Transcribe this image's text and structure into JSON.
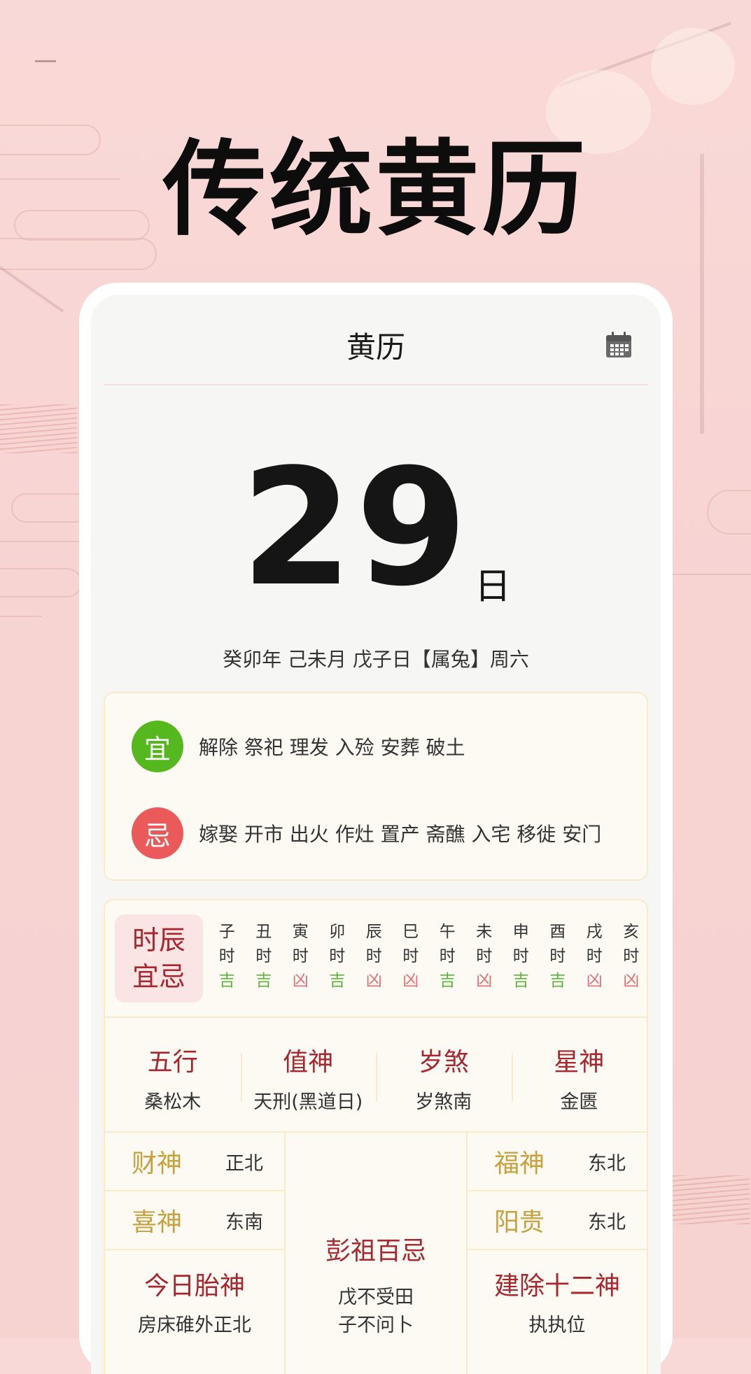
{
  "hero": {
    "title": "传统黄历"
  },
  "app": {
    "title": "黄历",
    "calendar_icon": "calendar-icon"
  },
  "date": {
    "day": "29",
    "unit": "日",
    "ganzhi": "癸卯年 己未月 戊子日【属兔】周六"
  },
  "yiji": {
    "yi_label": "宜",
    "yi_items": "解除 祭祀 理发 入殓 安葬 破土",
    "ji_label": "忌",
    "ji_items": "嫁娶 开市 出火 作灶 置产 斋醮 入宅 移徙 安门",
    "colors": {
      "yi": "#56b81f",
      "ji": "#ea5a5a"
    }
  },
  "shichen": {
    "label_line1": "时辰",
    "label_line2": "宜忌",
    "hours": [
      {
        "name": "子",
        "suffix": "时",
        "luck": "吉",
        "good": true
      },
      {
        "name": "丑",
        "suffix": "时",
        "luck": "吉",
        "good": true
      },
      {
        "name": "寅",
        "suffix": "时",
        "luck": "凶",
        "good": false
      },
      {
        "name": "卯",
        "suffix": "时",
        "luck": "吉",
        "good": true
      },
      {
        "name": "辰",
        "suffix": "时",
        "luck": "凶",
        "good": false
      },
      {
        "name": "巳",
        "suffix": "时",
        "luck": "凶",
        "good": false
      },
      {
        "name": "午",
        "suffix": "时",
        "luck": "吉",
        "good": true
      },
      {
        "name": "未",
        "suffix": "时",
        "luck": "凶",
        "good": false
      },
      {
        "name": "申",
        "suffix": "时",
        "luck": "吉",
        "good": true
      },
      {
        "name": "酉",
        "suffix": "时",
        "luck": "吉",
        "good": true
      },
      {
        "name": "戌",
        "suffix": "时",
        "luck": "凶",
        "good": false
      },
      {
        "name": "亥",
        "suffix": "时",
        "luck": "凶",
        "good": false
      }
    ]
  },
  "four": [
    {
      "title": "五行",
      "value": "桑松木"
    },
    {
      "title": "值神",
      "value": "天刑(黑道日)"
    },
    {
      "title": "岁煞",
      "value": "岁煞南"
    },
    {
      "title": "星神",
      "value": "金匮"
    }
  ],
  "gods": {
    "caishen": {
      "k": "财神",
      "v": "正北"
    },
    "xishen": {
      "k": "喜神",
      "v": "东南"
    },
    "fushen": {
      "k": "福神",
      "v": "东北"
    },
    "yanggui": {
      "k": "阳贵",
      "v": "东北"
    },
    "taishen": {
      "title": "今日胎神",
      "value": "房床碓外正北"
    },
    "pengzu": {
      "title": "彭祖百忌",
      "line1": "戊不受田",
      "line2": "子不问卜"
    },
    "jianchu": {
      "title": "建除十二神",
      "value": "执执位"
    }
  }
}
